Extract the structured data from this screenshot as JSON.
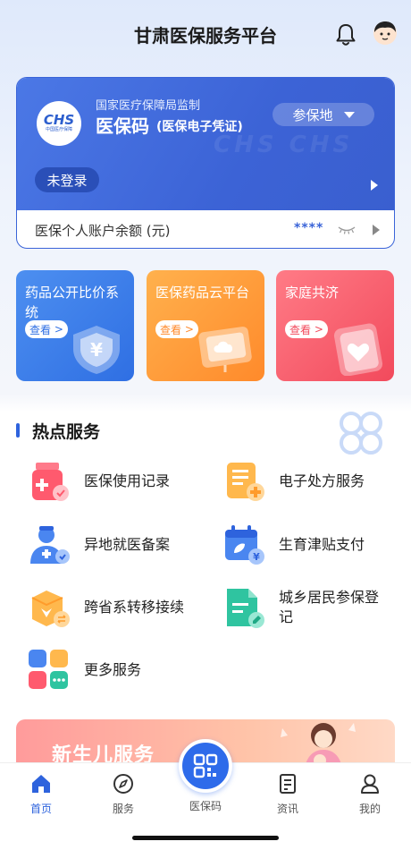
{
  "header": {
    "title": "甘肃医保服务平台"
  },
  "card": {
    "logo_text": "CHS",
    "logo_sub": "中国医疗保障",
    "supervision": "国家医疗保障局监制",
    "title": "医保码",
    "subtitle": "(医保电子凭证)",
    "region_label": "参保地",
    "login_label": "未登录",
    "balance_label": "医保个人账户余额 (元)",
    "balance_value": "****"
  },
  "features": [
    {
      "title": "药品公开比价系统",
      "button": "查看"
    },
    {
      "title": "医保药品云平台",
      "button": "查看"
    },
    {
      "title": "家庭共济",
      "button": "查看"
    }
  ],
  "section": {
    "title": "热点服务"
  },
  "services": [
    {
      "label": "医保使用记录",
      "icon": "medicine-bottle-icon"
    },
    {
      "label": "电子处方服务",
      "icon": "prescription-icon"
    },
    {
      "label": "异地就医备案",
      "icon": "doctor-icon"
    },
    {
      "label": "生育津贴支付",
      "icon": "calendar-payment-icon"
    },
    {
      "label": "跨省系转移接续",
      "icon": "transfer-box-icon"
    },
    {
      "label": "城乡居民参保登记",
      "icon": "document-edit-icon"
    },
    {
      "label": "更多服务",
      "icon": "more-grid-icon"
    }
  ],
  "banner": {
    "text": "新生儿服务"
  },
  "tabbar": {
    "home": "首页",
    "services": "服务",
    "qrcode": "医保码",
    "news": "资讯",
    "mine": "我的"
  },
  "colors": {
    "primary": "#2e63dd",
    "card_blue": "#3c63d6",
    "orange": "#ff8a2b",
    "red": "#f24a5c"
  }
}
